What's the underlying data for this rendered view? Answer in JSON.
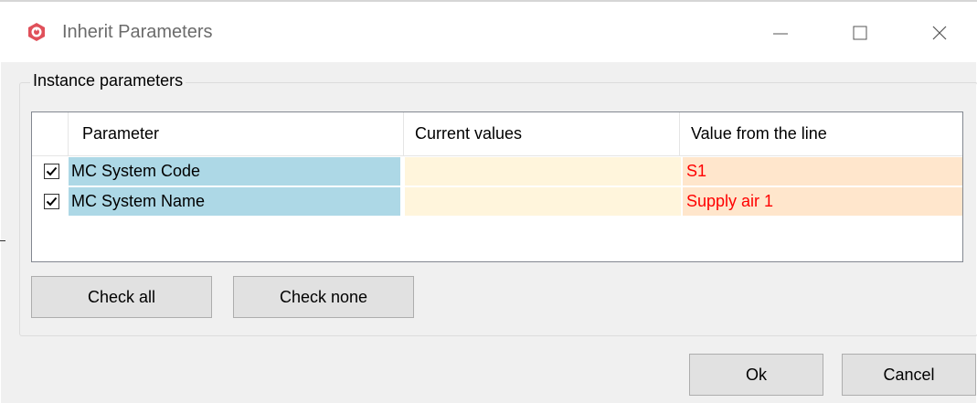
{
  "window": {
    "title": "Inherit Parameters",
    "icon": "app-logo-icon",
    "controls": [
      "minimize-icon",
      "maximize-icon",
      "close-icon"
    ]
  },
  "group": {
    "label": "Instance parameters"
  },
  "table": {
    "columns": [
      "Parameter",
      "Current values",
      "Value from the line"
    ],
    "rows": [
      {
        "checked": true,
        "parameter": "MC System Code",
        "current": "",
        "value": "S1"
      },
      {
        "checked": true,
        "parameter": "MC System Name",
        "current": "",
        "value": "Supply air 1"
      }
    ]
  },
  "buttons": {
    "check_all": "Check all",
    "check_none": "Check none",
    "ok": "Ok",
    "cancel": "Cancel"
  },
  "colors": {
    "parameter_cell": "#add8e6",
    "current_cell": "#fff5dc",
    "value_cell": "#ffe6cc",
    "value_text": "#ff0000",
    "app_icon": "#e0505a"
  }
}
